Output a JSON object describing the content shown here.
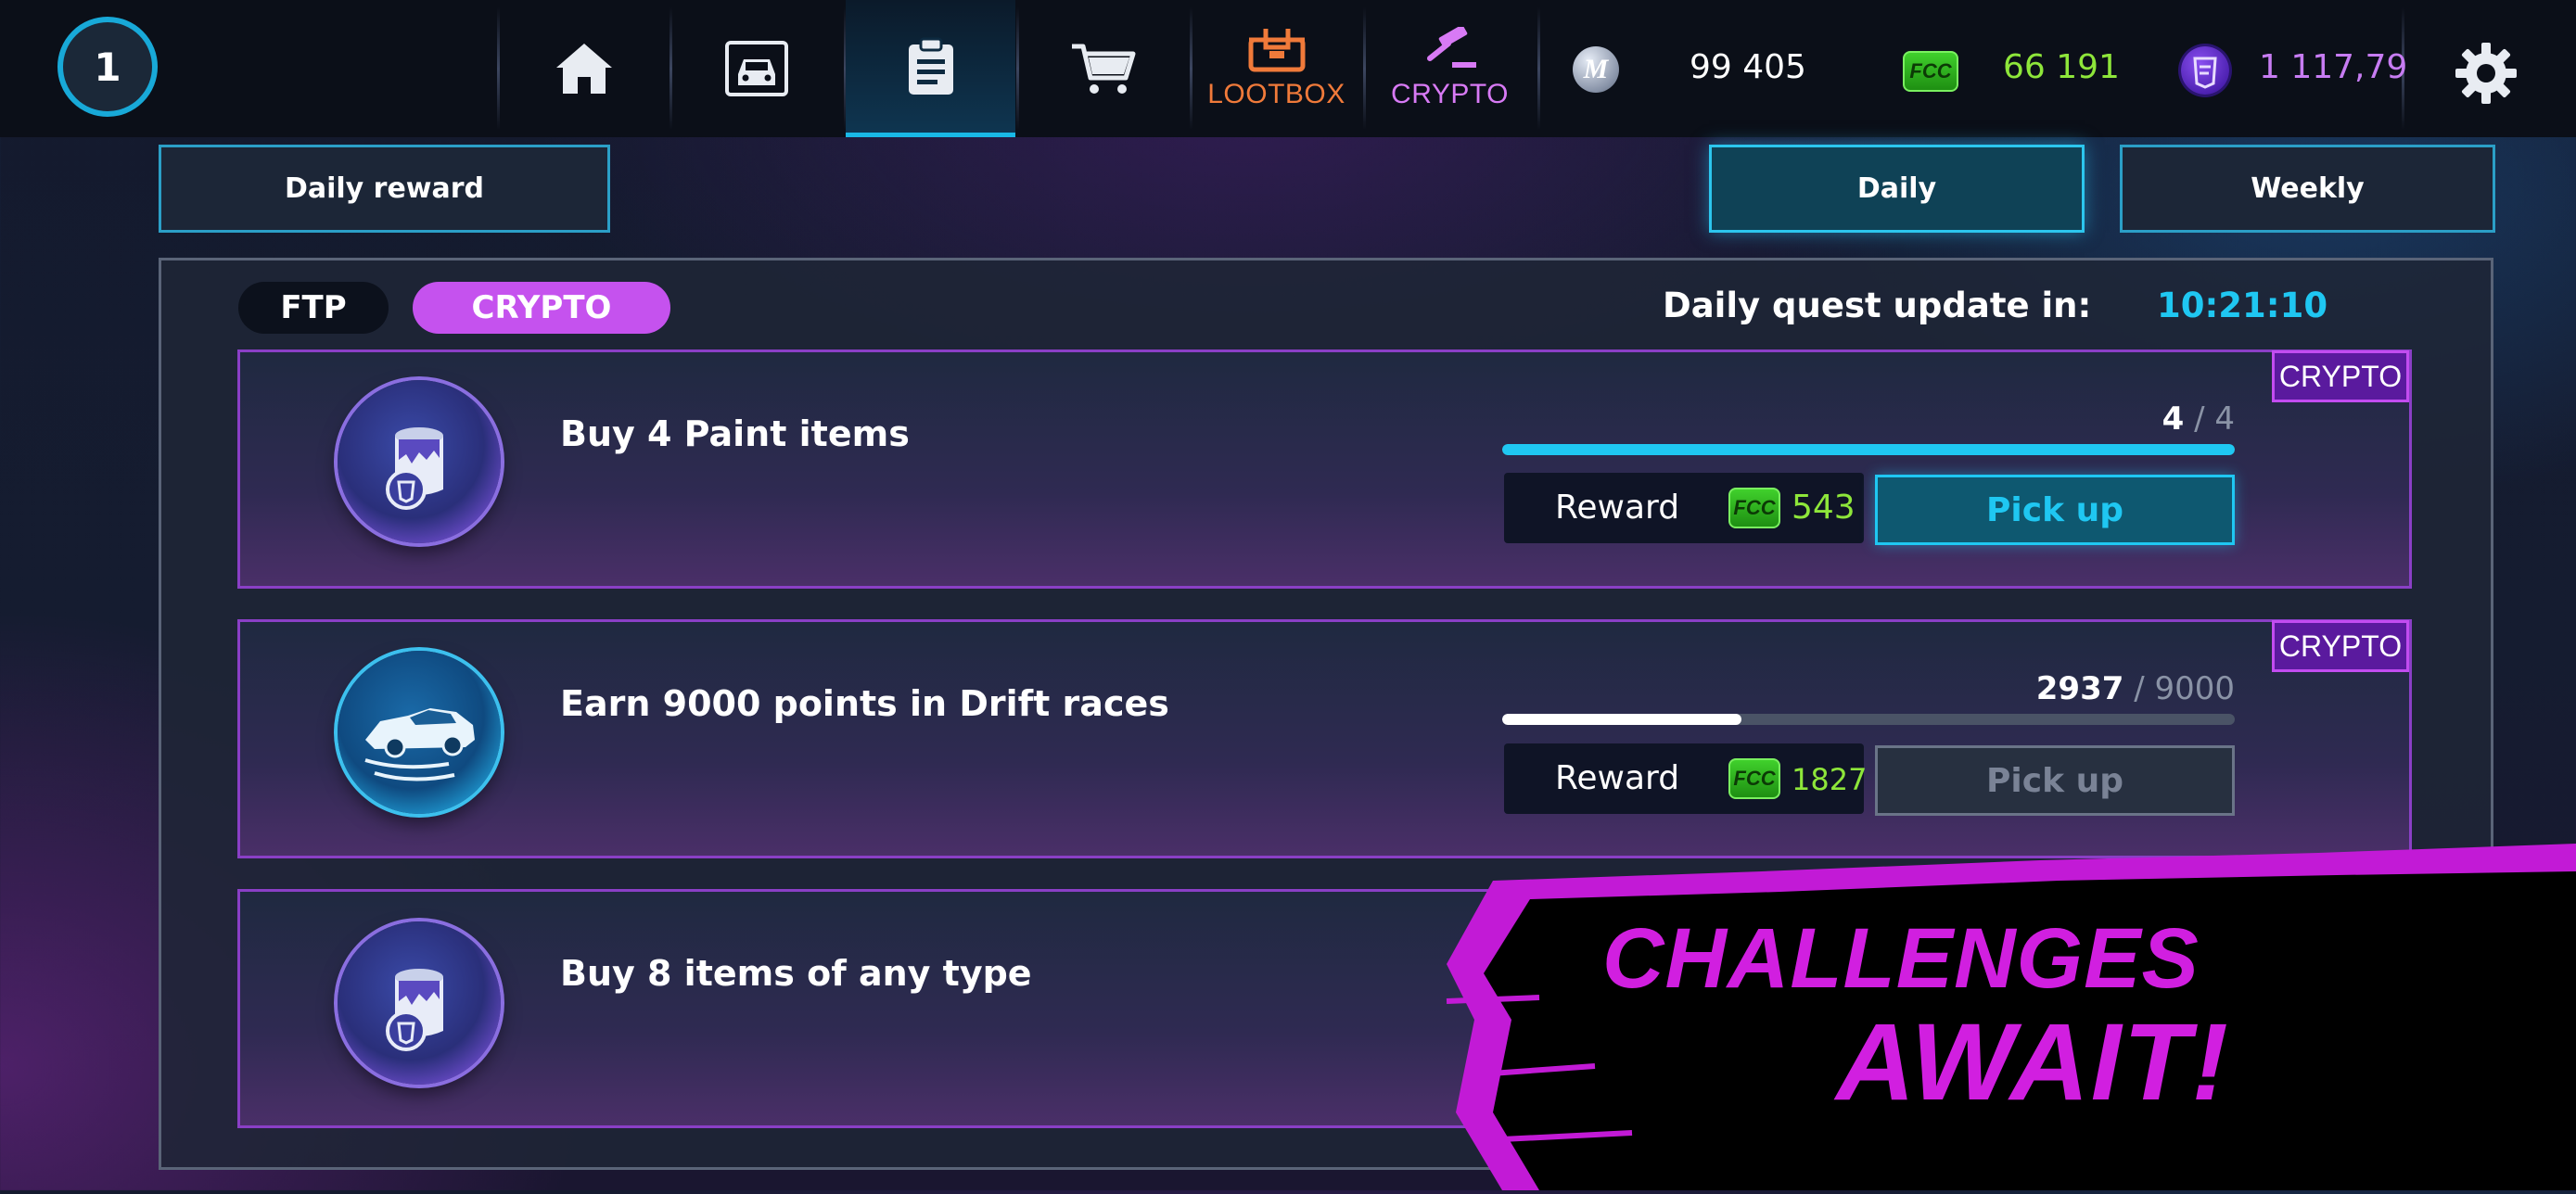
{
  "topbar": {
    "level": "1",
    "nav": [
      {
        "id": "home",
        "icon": "home-icon"
      },
      {
        "id": "garage",
        "icon": "car-front-icon"
      },
      {
        "id": "quests",
        "icon": "clipboard-icon",
        "active": true
      },
      {
        "id": "shop",
        "icon": "cart-icon"
      },
      {
        "id": "lootbox",
        "icon": "lootbox-icon",
        "label": "LOOTBOX",
        "color": "#f07a3a"
      },
      {
        "id": "crypto",
        "icon": "gavel-icon",
        "label": "CRYPTO",
        "color": "#d87af5"
      }
    ],
    "currencies": {
      "m_coin": {
        "icon": "m-coin-icon",
        "value": "99 405",
        "color": "#ffffff"
      },
      "fcc": {
        "icon": "fcc-icon",
        "badge": "FCC",
        "value": "66 191",
        "color": "#8ee63a"
      },
      "crypto": {
        "icon": "crypto-coin-icon",
        "value": "1 117,79",
        "color": "#c77cf2"
      }
    },
    "settings_icon": "gear-icon"
  },
  "buttons": {
    "daily_reward": "Daily reward",
    "daily": "Daily",
    "weekly": "Weekly"
  },
  "panel": {
    "filters": {
      "ftp": "FTP",
      "crypto": "CRYPTO"
    },
    "update_label": "Daily quest update in:",
    "update_timer": "10:21:10"
  },
  "quests": [
    {
      "title": "Buy 4 Paint items",
      "tag": "CRYPTO",
      "icon": "paint-bucket-icon",
      "progress_current": "4",
      "progress_total": "4",
      "progress_fraction": 1.0,
      "reward_label": "Reward",
      "reward_currency": "FCC",
      "reward_value": "543",
      "button": "Pick up",
      "button_enabled": true
    },
    {
      "title": "Earn 9000 points in Drift races",
      "tag": "CRYPTO",
      "icon": "drift-car-icon",
      "progress_current": "2937",
      "progress_total": "9000",
      "progress_fraction": 0.326,
      "reward_label": "Reward",
      "reward_currency": "FCC",
      "reward_value": "1827",
      "button": "Pick up",
      "button_enabled": false
    },
    {
      "title": "Buy 8 items of any type",
      "icon": "paint-bucket-icon"
    }
  ],
  "banner": {
    "line1": "CHALLENGES",
    "line2": "AWAIT!"
  },
  "colors": {
    "accent_cyan": "#1fc7f2",
    "crypto_purple": "#c24cf0",
    "fcc_green": "#8ee63a"
  }
}
